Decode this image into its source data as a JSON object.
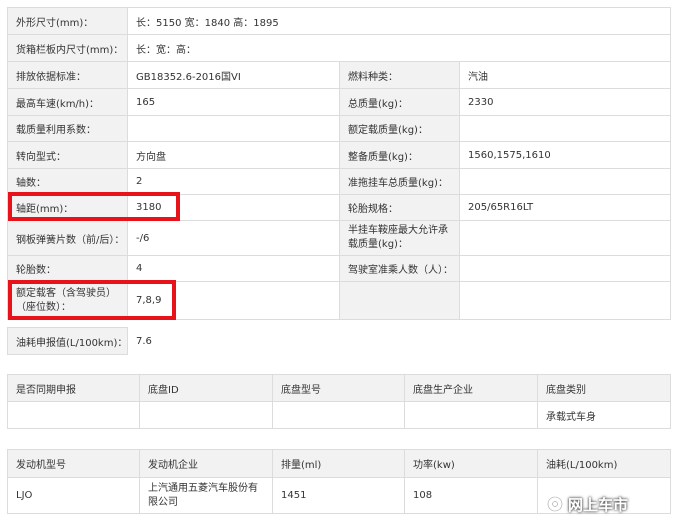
{
  "spec": {
    "outer_size": {
      "label": "外形尺寸(mm)：",
      "value": "长：5150 宽：1840 高：1895"
    },
    "cargo_size": {
      "label": "货箱栏板内尺寸(mm)：",
      "value": "长：宽：高："
    },
    "rows": [
      {
        "l1": "排放依据标准：",
        "v1": "GB18352.6-2016国VI",
        "l2": "燃料种类：",
        "v2": "汽油"
      },
      {
        "l1": "最高车速(km/h)：",
        "v1": "165",
        "l2": "总质量(kg)：",
        "v2": "2330"
      },
      {
        "l1": "载质量利用系数：",
        "v1": "",
        "l2": "额定载质量(kg)：",
        "v2": ""
      },
      {
        "l1": "转向型式：",
        "v1": "方向盘",
        "l2": "整备质量(kg)：",
        "v2": "1560,1575,1610"
      },
      {
        "l1": "轴数：",
        "v1": "2",
        "l2": "准拖挂车总质量(kg)：",
        "v2": ""
      },
      {
        "l1": "轴距(mm)：",
        "v1": "3180",
        "l2": "轮胎规格：",
        "v2": "205/65R16LT"
      },
      {
        "l1": "钢板弹簧片数（前/后）：",
        "v1": "-/6",
        "l2": "半挂车鞍座最大允许承载质量(kg)：",
        "v2": ""
      },
      {
        "l1": "轮胎数：",
        "v1": "4",
        "l2": "驾驶室准乘人数（人）：",
        "v2": ""
      },
      {
        "l1": "额定载客（含驾驶员）（座位数）：",
        "v1": "7,8,9",
        "l2": "",
        "v2": ""
      }
    ],
    "fuel": {
      "label": "油耗申报值(L/100km)：",
      "value": "7.6"
    }
  },
  "chassis": {
    "headers": [
      "是否同期申报",
      "底盘ID",
      "底盘型号",
      "底盘生产企业",
      "底盘类别"
    ],
    "values": [
      "",
      "",
      "",
      "",
      "承载式车身"
    ]
  },
  "engine": {
    "headers": [
      "发动机型号",
      "发动机企业",
      "排量(ml)",
      "功率(kw)",
      "油耗(L/100km)"
    ],
    "values": [
      "LJO",
      "上汽通用五菱汽车股份有限公司",
      "1451",
      "108",
      ""
    ]
  },
  "watermark": "网上车市",
  "highlight_color": "#e8121b"
}
